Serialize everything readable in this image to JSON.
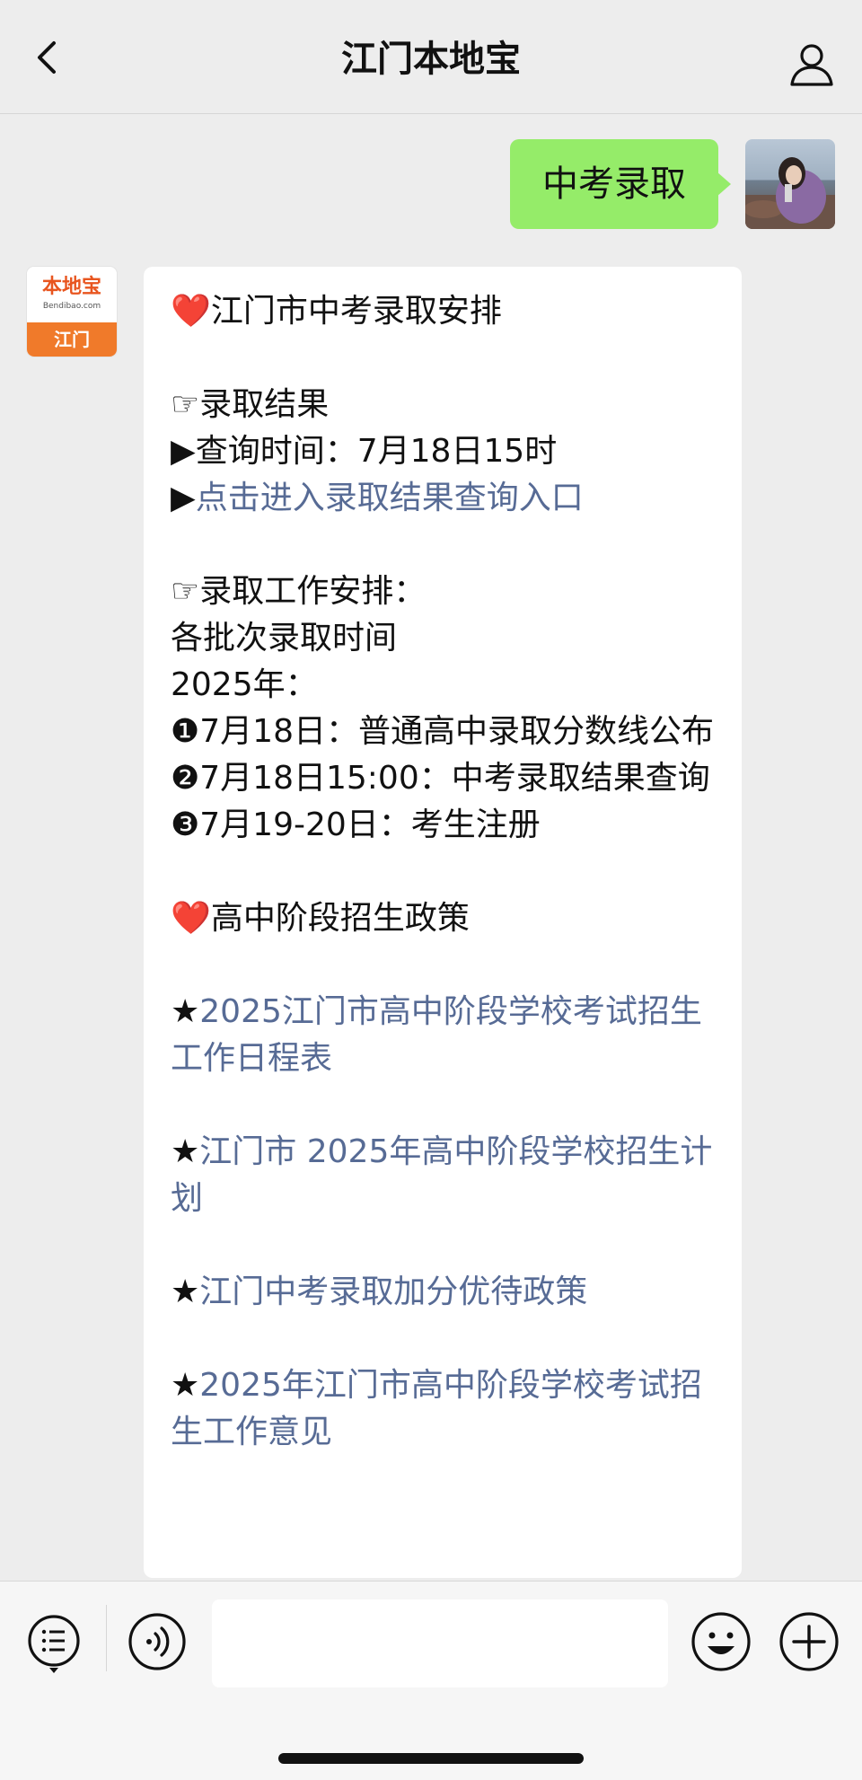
{
  "header": {
    "title": "江门本地宝",
    "back_icon": "chevron-left-icon",
    "profile_icon": "person-icon"
  },
  "messages": {
    "outgoing": {
      "text": "中考录取"
    },
    "incoming": {
      "avatar": {
        "logo": "本地宝",
        "logo_sub": "Bendibao.com",
        "city": "江门"
      },
      "lines": [
        {
          "prefix": "❤️",
          "text": "江门市中考录取安排"
        },
        {
          "prefix": "☞",
          "text": "录取结果"
        },
        {
          "prefix": "▶",
          "text": "查询时间：7月18日15时"
        },
        {
          "prefix": "▶",
          "text": "点击进入录取结果查询入口"
        },
        {
          "prefix": "☞",
          "text": "录取工作安排："
        },
        {
          "text": "各批次录取时间"
        },
        {
          "text": "2025年："
        },
        {
          "prefix": "❶",
          "text": "7月18日：普通高中录取分数线公布"
        },
        {
          "prefix": "❷",
          "text": "7月18日15:00：中考录取结果查询"
        },
        {
          "prefix": "❸",
          "text": "7月19-20日：考生注册"
        },
        {
          "prefix": "❤️",
          "text": "高中阶段招生政策"
        },
        {
          "prefix": "★",
          "text": "2025江门市高中阶段学校考试招生工作日程表"
        },
        {
          "prefix": "★",
          "text": "江门市 2025年高中阶段学校招生计划"
        },
        {
          "prefix": "★",
          "text": "江门中考录取加分优待政策"
        },
        {
          "prefix": "★",
          "text": "2025年江门市高中阶段学校考试招生工作意见"
        }
      ]
    }
  },
  "input_bar": {
    "menu_icon": "menu-list-icon",
    "voice_icon": "voice-icon",
    "emoji_icon": "emoji-icon",
    "plus_icon": "plus-icon",
    "placeholder": ""
  },
  "colors": {
    "outgoing_bubble": "#95ec69",
    "link": "#576b95",
    "background": "#ededed"
  }
}
